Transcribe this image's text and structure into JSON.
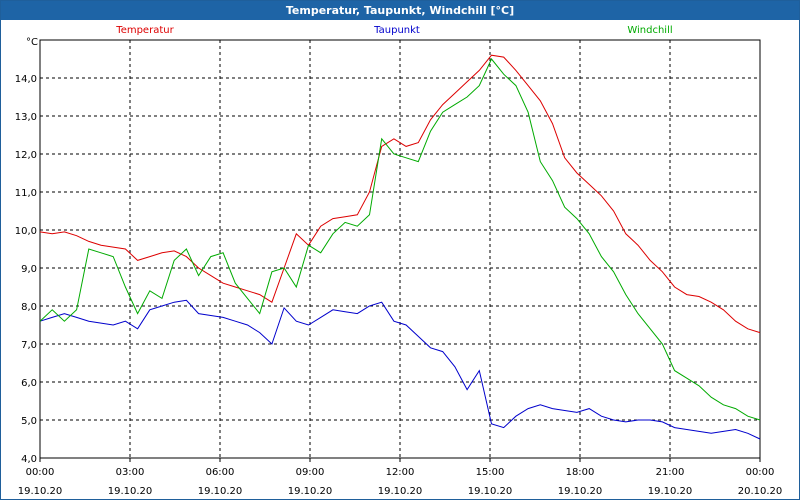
{
  "window": {
    "title": "Temperatur, Taupunkt, Windchill [°C]"
  },
  "chart_data": {
    "type": "line",
    "title": "Temperatur, Taupunkt, Windchill [°C]",
    "y_unit": "°C",
    "ylim": [
      4.0,
      15.0
    ],
    "grid": true,
    "legend_placement": "top",
    "y_ticks": [
      "4,0",
      "5,0",
      "6,0",
      "7,0",
      "8,0",
      "9,0",
      "10,0",
      "11,0",
      "12,0",
      "13,0",
      "14,0"
    ],
    "x_ticks": [
      {
        "time": "00:00",
        "date": "19.10.20"
      },
      {
        "time": "03:00",
        "date": "19.10.20"
      },
      {
        "time": "06:00",
        "date": "19.10.20"
      },
      {
        "time": "09:00",
        "date": "19.10.20"
      },
      {
        "time": "12:00",
        "date": "19.10.20"
      },
      {
        "time": "15:00",
        "date": "19.10.20"
      },
      {
        "time": "18:00",
        "date": "19.10.20"
      },
      {
        "time": "21:00",
        "date": "19.10.20"
      },
      {
        "time": "00:00",
        "date": "20.10.20"
      }
    ],
    "x_hours": [
      0,
      0.5,
      1,
      1.5,
      2,
      2.5,
      3,
      3.5,
      4,
      4.5,
      5,
      5.5,
      6,
      6.5,
      7,
      7.5,
      8,
      8.5,
      9,
      9.5,
      10,
      10.5,
      11,
      11.5,
      12,
      12.5,
      13,
      13.5,
      14,
      14.5,
      15,
      15.5,
      16,
      16.5,
      17,
      17.5,
      18,
      18.5,
      19,
      19.5,
      20,
      20.5,
      21,
      21.5,
      22,
      22.5,
      23,
      23.5,
      24
    ],
    "series": [
      {
        "name": "Temperatur",
        "color": "#dd0000",
        "values": [
          9.95,
          9.9,
          9.95,
          9.85,
          9.7,
          9.6,
          9.55,
          9.5,
          9.2,
          9.3,
          9.4,
          9.45,
          9.3,
          9.0,
          8.8,
          8.6,
          8.5,
          8.4,
          8.3,
          8.1,
          9.0,
          9.9,
          9.6,
          10.1,
          10.3,
          10.35,
          10.4,
          11.0,
          12.2,
          12.4,
          12.2,
          12.3,
          12.9,
          13.3,
          13.6,
          13.9,
          14.2,
          14.6,
          14.55,
          14.2,
          13.8,
          13.4,
          12.8,
          11.9,
          11.5,
          11.2,
          10.9,
          10.5,
          9.9,
          9.6,
          9.2,
          8.9,
          8.5,
          8.3,
          8.25,
          8.1,
          7.9,
          7.6,
          7.4,
          7.3
        ]
      },
      {
        "name": "Taupunkt",
        "color": "#0000cc",
        "values": [
          7.6,
          7.7,
          7.8,
          7.7,
          7.6,
          7.55,
          7.5,
          7.6,
          7.4,
          7.9,
          8.0,
          8.1,
          8.15,
          7.8,
          7.75,
          7.7,
          7.6,
          7.5,
          7.3,
          7.0,
          7.95,
          7.6,
          7.5,
          7.7,
          7.9,
          7.85,
          7.8,
          8.0,
          8.1,
          7.6,
          7.5,
          7.2,
          6.9,
          6.8,
          6.4,
          5.8,
          6.3,
          4.9,
          4.8,
          5.1,
          5.3,
          5.4,
          5.3,
          5.25,
          5.2,
          5.3,
          5.1,
          5.0,
          4.95,
          5.0,
          5.0,
          4.95,
          4.8,
          4.75,
          4.7,
          4.65,
          4.7,
          4.75,
          4.65,
          4.5
        ]
      },
      {
        "name": "Windchill",
        "color": "#00aa00",
        "values": [
          7.6,
          7.9,
          7.6,
          7.9,
          9.5,
          9.4,
          9.3,
          8.5,
          7.8,
          8.4,
          8.2,
          9.2,
          9.5,
          8.8,
          9.3,
          9.4,
          8.6,
          8.2,
          7.8,
          8.9,
          9.0,
          8.5,
          9.6,
          9.4,
          9.9,
          10.2,
          10.1,
          10.4,
          12.4,
          12.0,
          11.9,
          11.8,
          12.6,
          13.1,
          13.3,
          13.5,
          13.8,
          14.5,
          14.1,
          13.8,
          13.1,
          11.8,
          11.3,
          10.6,
          10.3,
          9.9,
          9.3,
          8.9,
          8.3,
          7.8,
          7.4,
          7.0,
          6.3,
          6.1,
          5.9,
          5.6,
          5.4,
          5.3,
          5.1,
          5.0
        ]
      }
    ]
  }
}
